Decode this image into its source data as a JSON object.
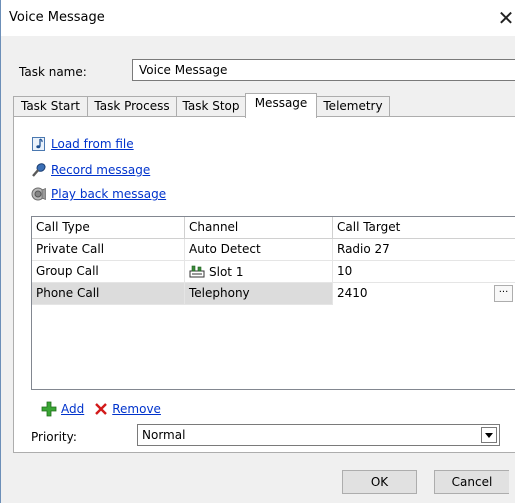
{
  "window": {
    "title": "Voice Message",
    "close_symbol": "✕"
  },
  "task": {
    "label": "Task name:",
    "value": "Voice Message"
  },
  "tabs": [
    {
      "label": "Task Start",
      "active": false
    },
    {
      "label": "Task Process",
      "active": false
    },
    {
      "label": "Task Stop",
      "active": false
    },
    {
      "label": "Message",
      "active": true
    },
    {
      "label": "Telemetry",
      "active": false
    }
  ],
  "message_actions": {
    "load": {
      "label": "Load from file",
      "icon": "music-note-file-icon"
    },
    "record": {
      "label": "Record message",
      "icon": "microphone-icon"
    },
    "playback": {
      "label": "Play back message",
      "icon": "speaker-icon"
    }
  },
  "grid": {
    "columns": [
      "Call Type",
      "Channel",
      "Call Target"
    ],
    "rows": [
      {
        "call_type": "Private Call",
        "channel": "Auto Detect",
        "channel_icon": "",
        "target": "Radio 27",
        "selected": false
      },
      {
        "call_type": "Group Call",
        "channel": "Slot 1",
        "channel_icon": "radio-slot-icon",
        "target": "10",
        "selected": false
      },
      {
        "call_type": "Phone Call",
        "channel": "Telephony",
        "channel_icon": "",
        "target": "2410",
        "selected": true,
        "ellipsis": "···"
      }
    ]
  },
  "list_actions": {
    "add": "Add",
    "remove": "Remove"
  },
  "priority": {
    "label": "Priority:",
    "value": "Normal"
  },
  "buttons": {
    "ok": "OK",
    "cancel": "Cancel"
  }
}
